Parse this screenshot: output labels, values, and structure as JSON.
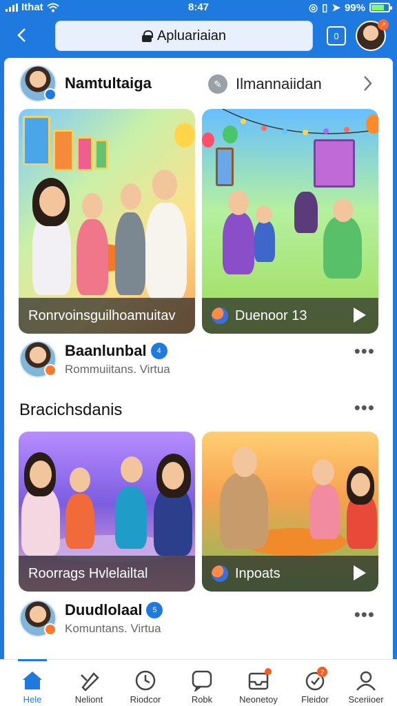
{
  "status_bar": {
    "carrier": "Ithat",
    "time": "8:47",
    "battery": "99%"
  },
  "nav": {
    "url_text": "Apluariaian",
    "tabs_count": "0"
  },
  "feed_item_1": {
    "name": "Namtultaiga",
    "secondary": "Ilmannaiidan"
  },
  "cards_row_1": [
    {
      "caption": "Ronrvoinsguilhoamuitav",
      "has_play": false
    },
    {
      "caption": "Duenoor 13",
      "has_play": true
    }
  ],
  "feed_item_2": {
    "name": "Baanlunbal",
    "subtitle": "Rommuiitans. Virtua",
    "verified_label": "4"
  },
  "section": {
    "title": "Bracichsdanis"
  },
  "cards_row_2": [
    {
      "caption": "Roorrags Hvlelailtal",
      "has_play": false
    },
    {
      "caption": "Inpoats",
      "has_play": true
    }
  ],
  "feed_item_3": {
    "name": "Duudlolaal",
    "subtitle": "Komuntans. Virtua",
    "verified_label": "5"
  },
  "tabbar": [
    {
      "label": "Hele",
      "icon": "home-icon",
      "active": true
    },
    {
      "label": "Neliont",
      "icon": "tools-icon",
      "active": false
    },
    {
      "label": "Riodcor",
      "icon": "clock-icon",
      "active": false
    },
    {
      "label": "Robk",
      "icon": "chat-icon",
      "active": false
    },
    {
      "label": "Neonetoy",
      "icon": "inbox-icon",
      "active": false,
      "badge": ""
    },
    {
      "label": "Fleidor",
      "icon": "heart-icon",
      "active": false,
      "badge": "2"
    },
    {
      "label": "Sceriioer",
      "icon": "profile-icon",
      "active": false
    }
  ],
  "colors": {
    "accent": "#1f7ae0",
    "badge": "#ff5a1f"
  }
}
